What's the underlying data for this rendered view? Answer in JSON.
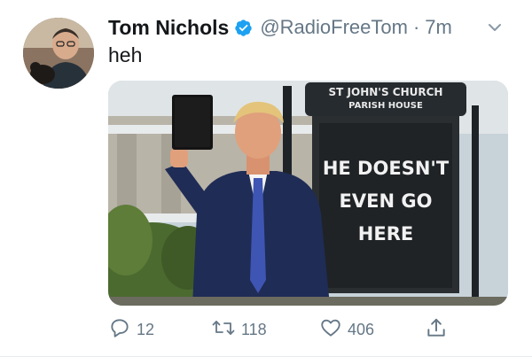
{
  "tweet": {
    "display_name": "Tom Nichols",
    "handle": "@RadioFreeTom",
    "separator": "·",
    "time": "7m",
    "text": "heh",
    "verified": true
  },
  "media": {
    "sign_line1": "ST JOHN'S CHURCH",
    "sign_line2": "PARISH HOUSE",
    "sign_message": [
      "HE DOESN'T",
      "EVEN GO",
      "HERE"
    ]
  },
  "actions": {
    "reply_count": "12",
    "retweet_count": "118",
    "like_count": "406"
  },
  "colors": {
    "verified_blue": "#1da1f2",
    "secondary_text": "#657786",
    "primary_text": "#14171a"
  },
  "icons": [
    "verified-badge-icon",
    "chevron-down-icon",
    "reply-icon",
    "retweet-icon",
    "like-icon",
    "share-icon"
  ]
}
